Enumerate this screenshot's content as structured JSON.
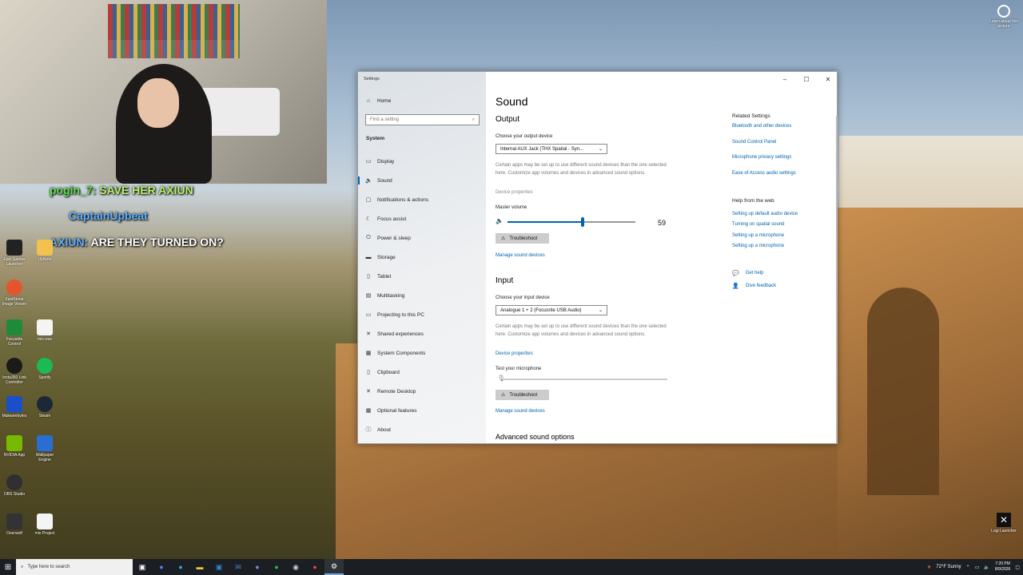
{
  "stream_overlay": {
    "chat": [
      {
        "user": "pogin_7:",
        "text": "SAVE HER AXIUN"
      },
      {
        "user": "CaptainUpbeat",
        "text": ""
      },
      {
        "user": "AXIUN:",
        "text": "ARE THEY TURNED ON?"
      }
    ]
  },
  "desktop": {
    "icons": [
      {
        "label": "Epic Games Launcher",
        "icon": "epic-games-icon"
      },
      {
        "label": "UpNote",
        "icon": "upnote-icon"
      },
      {
        "label": "FastStone Image Viewer",
        "icon": "faststone-icon"
      },
      {
        "label": "Focusrite Control",
        "icon": "focusrite-icon"
      },
      {
        "label": "mix.wav",
        "icon": "audio-file-icon"
      },
      {
        "label": "Insta360 Link Controller",
        "icon": "insta360-icon"
      },
      {
        "label": "Spotify",
        "icon": "spotify-icon"
      },
      {
        "label": "Malwarebytes",
        "icon": "malwarebytes-icon"
      },
      {
        "label": "Steam",
        "icon": "steam-icon"
      },
      {
        "label": "NVIDIA App",
        "icon": "nvidia-icon"
      },
      {
        "label": "Wallpaper Engine",
        "icon": "wallpaper-engine-icon"
      },
      {
        "label": "OBS Studio",
        "icon": "obs-icon"
      },
      {
        "label": "Overwolf",
        "icon": "overwolf-icon"
      },
      {
        "label": "mix Project",
        "icon": "project-file-icon"
      }
    ],
    "top_right_icon": {
      "label": "Learn about this picture",
      "icon": "camera-icon"
    },
    "bottom_right_icon": {
      "label": "Logi Launcher",
      "icon": "logi-icon"
    }
  },
  "window": {
    "title": "Settings",
    "controls": {
      "minimize": "–",
      "maximize": "☐",
      "close": "✕"
    },
    "sidebar": {
      "home": "Home",
      "search_placeholder": "Find a setting",
      "section": "System",
      "items": [
        {
          "label": "Display",
          "icon": "display-icon",
          "glyph": "▭"
        },
        {
          "label": "Sound",
          "icon": "speaker-icon",
          "glyph": "🔈",
          "active": true
        },
        {
          "label": "Notifications & actions",
          "icon": "notifications-icon",
          "glyph": "▢"
        },
        {
          "label": "Focus assist",
          "icon": "moon-icon",
          "glyph": "☾"
        },
        {
          "label": "Power & sleep",
          "icon": "power-icon",
          "glyph": "⏻"
        },
        {
          "label": "Storage",
          "icon": "storage-icon",
          "glyph": "▬"
        },
        {
          "label": "Tablet",
          "icon": "tablet-icon",
          "glyph": "▯"
        },
        {
          "label": "Multitasking",
          "icon": "multitasking-icon",
          "glyph": "▤"
        },
        {
          "label": "Projecting to this PC",
          "icon": "projecting-icon",
          "glyph": "▭"
        },
        {
          "label": "Shared experiences",
          "icon": "shared-icon",
          "glyph": "✕"
        },
        {
          "label": "System Components",
          "icon": "components-icon",
          "glyph": "▦"
        },
        {
          "label": "Clipboard",
          "icon": "clipboard-icon",
          "glyph": "▯"
        },
        {
          "label": "Remote Desktop",
          "icon": "remote-desktop-icon",
          "glyph": "✕"
        },
        {
          "label": "Optional features",
          "icon": "optional-features-icon",
          "glyph": "▦"
        },
        {
          "label": "About",
          "icon": "info-icon",
          "glyph": "ⓘ"
        }
      ]
    },
    "main": {
      "title": "Sound",
      "output": {
        "heading": "Output",
        "choose_label": "Choose your output device",
        "device": "Internal AUX Jack (THX Spatial - Syn...",
        "info": "Certain apps may be set up to use different sound devices than the one selected here. Customize app volumes and devices in advanced sound options.",
        "device_properties": "Device properties",
        "master_volume_label": "Master volume",
        "volume": 59,
        "troubleshoot": "Troubleshoot",
        "manage": "Manage sound devices"
      },
      "input": {
        "heading": "Input",
        "choose_label": "Choose your input device",
        "device": "Analogue 1 + 2 (Focusrite USB Audio)",
        "info": "Certain apps may be set up to use different sound devices than the one selected here. Customize app volumes and devices in advanced sound options.",
        "device_properties": "Device properties",
        "test_label": "Test your microphone",
        "troubleshoot": "Troubleshoot",
        "manage": "Manage sound devices"
      },
      "advanced": "Advanced sound options"
    },
    "related": {
      "heading": "Related Settings",
      "links": [
        "Bluetooth and other devices",
        "Sound Control Panel",
        "Microphone privacy settings",
        "Ease of Access audio settings"
      ],
      "web_heading": "Help from the web",
      "web_links": [
        "Setting up default audio device",
        "Turning on spatial sound",
        "Setting up a microphone",
        "Setting up a microphone"
      ],
      "get_help": "Get help",
      "give_feedback": "Give feedback"
    }
  },
  "taskbar": {
    "search_placeholder": "Type here to search",
    "weather": "72°F  Sunny",
    "time": "7:20 PM",
    "date": "8/9/2026"
  },
  "colors": {
    "accent": "#0063b1",
    "link": "#0063b1",
    "taskbar": "#1b1e22"
  }
}
